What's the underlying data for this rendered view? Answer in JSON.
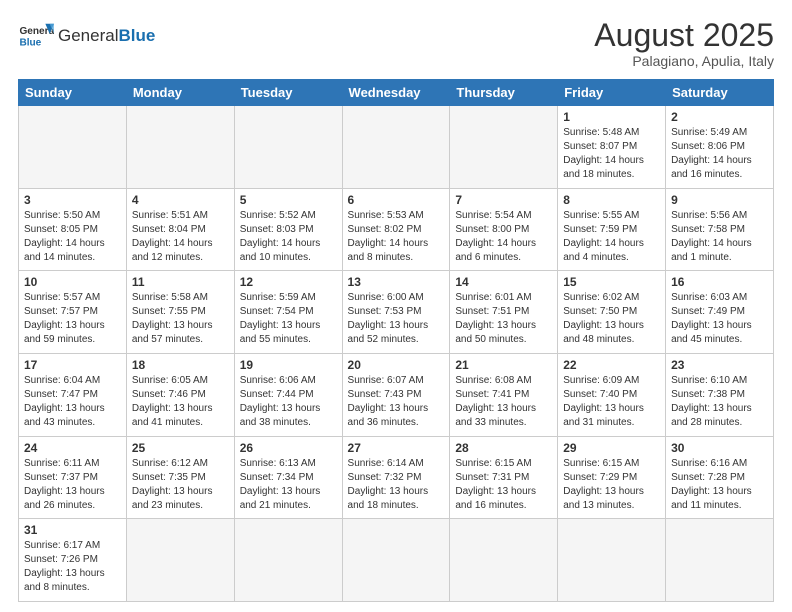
{
  "logo": {
    "text_general": "General",
    "text_blue": "Blue"
  },
  "header": {
    "month_year": "August 2025",
    "location": "Palagiano, Apulia, Italy"
  },
  "weekdays": [
    "Sunday",
    "Monday",
    "Tuesday",
    "Wednesday",
    "Thursday",
    "Friday",
    "Saturday"
  ],
  "weeks": [
    [
      {
        "day": "",
        "info": ""
      },
      {
        "day": "",
        "info": ""
      },
      {
        "day": "",
        "info": ""
      },
      {
        "day": "",
        "info": ""
      },
      {
        "day": "",
        "info": ""
      },
      {
        "day": "1",
        "info": "Sunrise: 5:48 AM\nSunset: 8:07 PM\nDaylight: 14 hours and 18 minutes."
      },
      {
        "day": "2",
        "info": "Sunrise: 5:49 AM\nSunset: 8:06 PM\nDaylight: 14 hours and 16 minutes."
      }
    ],
    [
      {
        "day": "3",
        "info": "Sunrise: 5:50 AM\nSunset: 8:05 PM\nDaylight: 14 hours and 14 minutes."
      },
      {
        "day": "4",
        "info": "Sunrise: 5:51 AM\nSunset: 8:04 PM\nDaylight: 14 hours and 12 minutes."
      },
      {
        "day": "5",
        "info": "Sunrise: 5:52 AM\nSunset: 8:03 PM\nDaylight: 14 hours and 10 minutes."
      },
      {
        "day": "6",
        "info": "Sunrise: 5:53 AM\nSunset: 8:02 PM\nDaylight: 14 hours and 8 minutes."
      },
      {
        "day": "7",
        "info": "Sunrise: 5:54 AM\nSunset: 8:00 PM\nDaylight: 14 hours and 6 minutes."
      },
      {
        "day": "8",
        "info": "Sunrise: 5:55 AM\nSunset: 7:59 PM\nDaylight: 14 hours and 4 minutes."
      },
      {
        "day": "9",
        "info": "Sunrise: 5:56 AM\nSunset: 7:58 PM\nDaylight: 14 hours and 1 minute."
      }
    ],
    [
      {
        "day": "10",
        "info": "Sunrise: 5:57 AM\nSunset: 7:57 PM\nDaylight: 13 hours and 59 minutes."
      },
      {
        "day": "11",
        "info": "Sunrise: 5:58 AM\nSunset: 7:55 PM\nDaylight: 13 hours and 57 minutes."
      },
      {
        "day": "12",
        "info": "Sunrise: 5:59 AM\nSunset: 7:54 PM\nDaylight: 13 hours and 55 minutes."
      },
      {
        "day": "13",
        "info": "Sunrise: 6:00 AM\nSunset: 7:53 PM\nDaylight: 13 hours and 52 minutes."
      },
      {
        "day": "14",
        "info": "Sunrise: 6:01 AM\nSunset: 7:51 PM\nDaylight: 13 hours and 50 minutes."
      },
      {
        "day": "15",
        "info": "Sunrise: 6:02 AM\nSunset: 7:50 PM\nDaylight: 13 hours and 48 minutes."
      },
      {
        "day": "16",
        "info": "Sunrise: 6:03 AM\nSunset: 7:49 PM\nDaylight: 13 hours and 45 minutes."
      }
    ],
    [
      {
        "day": "17",
        "info": "Sunrise: 6:04 AM\nSunset: 7:47 PM\nDaylight: 13 hours and 43 minutes."
      },
      {
        "day": "18",
        "info": "Sunrise: 6:05 AM\nSunset: 7:46 PM\nDaylight: 13 hours and 41 minutes."
      },
      {
        "day": "19",
        "info": "Sunrise: 6:06 AM\nSunset: 7:44 PM\nDaylight: 13 hours and 38 minutes."
      },
      {
        "day": "20",
        "info": "Sunrise: 6:07 AM\nSunset: 7:43 PM\nDaylight: 13 hours and 36 minutes."
      },
      {
        "day": "21",
        "info": "Sunrise: 6:08 AM\nSunset: 7:41 PM\nDaylight: 13 hours and 33 minutes."
      },
      {
        "day": "22",
        "info": "Sunrise: 6:09 AM\nSunset: 7:40 PM\nDaylight: 13 hours and 31 minutes."
      },
      {
        "day": "23",
        "info": "Sunrise: 6:10 AM\nSunset: 7:38 PM\nDaylight: 13 hours and 28 minutes."
      }
    ],
    [
      {
        "day": "24",
        "info": "Sunrise: 6:11 AM\nSunset: 7:37 PM\nDaylight: 13 hours and 26 minutes."
      },
      {
        "day": "25",
        "info": "Sunrise: 6:12 AM\nSunset: 7:35 PM\nDaylight: 13 hours and 23 minutes."
      },
      {
        "day": "26",
        "info": "Sunrise: 6:13 AM\nSunset: 7:34 PM\nDaylight: 13 hours and 21 minutes."
      },
      {
        "day": "27",
        "info": "Sunrise: 6:14 AM\nSunset: 7:32 PM\nDaylight: 13 hours and 18 minutes."
      },
      {
        "day": "28",
        "info": "Sunrise: 6:15 AM\nSunset: 7:31 PM\nDaylight: 13 hours and 16 minutes."
      },
      {
        "day": "29",
        "info": "Sunrise: 6:15 AM\nSunset: 7:29 PM\nDaylight: 13 hours and 13 minutes."
      },
      {
        "day": "30",
        "info": "Sunrise: 6:16 AM\nSunset: 7:28 PM\nDaylight: 13 hours and 11 minutes."
      }
    ],
    [
      {
        "day": "31",
        "info": "Sunrise: 6:17 AM\nSunset: 7:26 PM\nDaylight: 13 hours and 8 minutes."
      },
      {
        "day": "",
        "info": ""
      },
      {
        "day": "",
        "info": ""
      },
      {
        "day": "",
        "info": ""
      },
      {
        "day": "",
        "info": ""
      },
      {
        "day": "",
        "info": ""
      },
      {
        "day": "",
        "info": ""
      }
    ]
  ]
}
